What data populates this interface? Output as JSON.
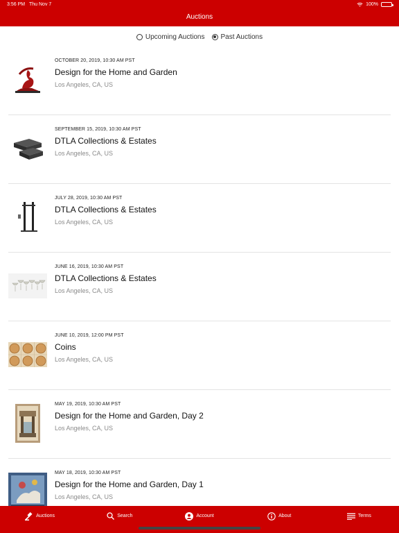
{
  "status": {
    "time": "3:56 PM",
    "date": "Thu Nov 7",
    "battery": "100%"
  },
  "nav": {
    "title": "Auctions"
  },
  "segment": {
    "upcoming": "Upcoming Auctions",
    "past": "Past Auctions",
    "selected": "past"
  },
  "auctions": [
    {
      "date": "OCTOBER 20, 2019, 10:30 AM PST",
      "title": "Design for the Home and Garden",
      "location": "Los Angeles, CA, US",
      "thumb": "sculpture"
    },
    {
      "date": "SEPTEMBER 15, 2019, 10:30 AM PST",
      "title": "DTLA Collections & Estates",
      "location": "Los Angeles, CA, US",
      "thumb": "boxes"
    },
    {
      "date": "JULY 28, 2019, 10:30 AM PST",
      "title": "DTLA Collections & Estates",
      "location": "Los Angeles, CA, US",
      "thumb": "stand"
    },
    {
      "date": "JUNE 16, 2019, 10:30 AM PST",
      "title": "DTLA Collections & Estates",
      "location": "Los Angeles, CA, US",
      "thumb": "glasses"
    },
    {
      "date": "JUNE 10, 2019, 12:00 PM PST",
      "title": "Coins",
      "location": "Los Angeles, CA, US",
      "thumb": "coins"
    },
    {
      "date": "MAY 19, 2019, 10:30 AM PST",
      "title": "Design for the Home and Garden, Day 2",
      "location": "Los Angeles, CA, US",
      "thumb": "painting"
    },
    {
      "date": "MAY 18, 2019, 10:30 AM PST",
      "title": "Design for the Home and Garden, Day 1",
      "location": "Los Angeles, CA, US",
      "thumb": "rug"
    }
  ],
  "tabs": [
    {
      "label": "Auctions",
      "icon": "gavel-icon"
    },
    {
      "label": "Search",
      "icon": "search-icon"
    },
    {
      "label": "Account",
      "icon": "account-icon"
    },
    {
      "label": "About",
      "icon": "info-icon"
    },
    {
      "label": "Terms",
      "icon": "list-icon"
    }
  ],
  "colors": {
    "brand": "#cc0000",
    "text": "#111111",
    "muted": "#8a8a8a"
  }
}
